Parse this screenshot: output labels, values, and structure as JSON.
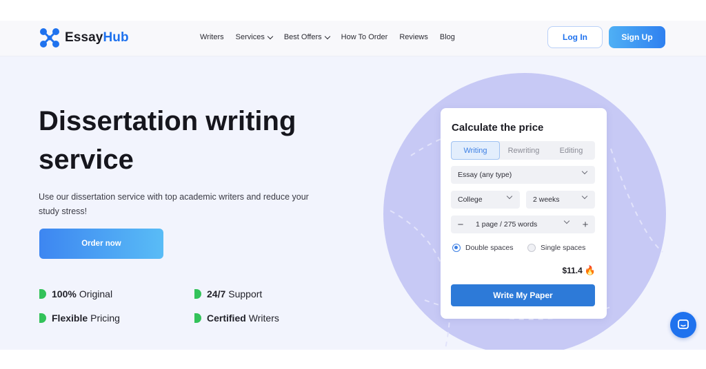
{
  "header": {
    "logo": {
      "prefix": "Essay",
      "suffix": "Hub",
      "icon": "molecule-logo-icon"
    },
    "nav": [
      {
        "label": "Writers",
        "dropdown": false
      },
      {
        "label": "Services",
        "dropdown": true
      },
      {
        "label": "Best Offers",
        "dropdown": true
      },
      {
        "label": "How To Order",
        "dropdown": false
      },
      {
        "label": "Reviews",
        "dropdown": false
      },
      {
        "label": "Blog",
        "dropdown": false
      }
    ],
    "login_label": "Log In",
    "signup_label": "Sign Up"
  },
  "hero": {
    "title_line1": "Dissertation writing",
    "title_line2": "service",
    "subtitle": "Use our dissertation service with top academic writers and reduce your study stress!",
    "order_button": "Order now",
    "features": [
      {
        "bold": "100%",
        "rest": "Original"
      },
      {
        "bold": "24/7",
        "rest": "Support"
      },
      {
        "bold": "Flexible",
        "rest": "Pricing"
      },
      {
        "bold": "Certified",
        "rest": "Writers"
      }
    ]
  },
  "calculator": {
    "title": "Calculate the price",
    "tabs": [
      {
        "label": "Writing",
        "active": true
      },
      {
        "label": "Rewriting",
        "active": false
      },
      {
        "label": "Editing",
        "active": false
      }
    ],
    "paper_type": "Essay (any type)",
    "academic_level": "College",
    "deadline": "2 weeks",
    "pages": "1 page / 275 words",
    "minus_symbol": "−",
    "plus_symbol": "+",
    "spacing_options": [
      {
        "label": "Double spaces",
        "checked": true
      },
      {
        "label": "Single spaces",
        "checked": false
      }
    ],
    "price": "$11.4",
    "price_icon": "flame-icon",
    "submit_label": "Write My Paper"
  },
  "colors": {
    "brand_blue": "#1f72ee",
    "feature_green": "#33c25a",
    "circle_lavender": "#c7c9f5",
    "hero_bg": "#f2f4fd"
  },
  "chat_icon": "chat-bubble-icon"
}
